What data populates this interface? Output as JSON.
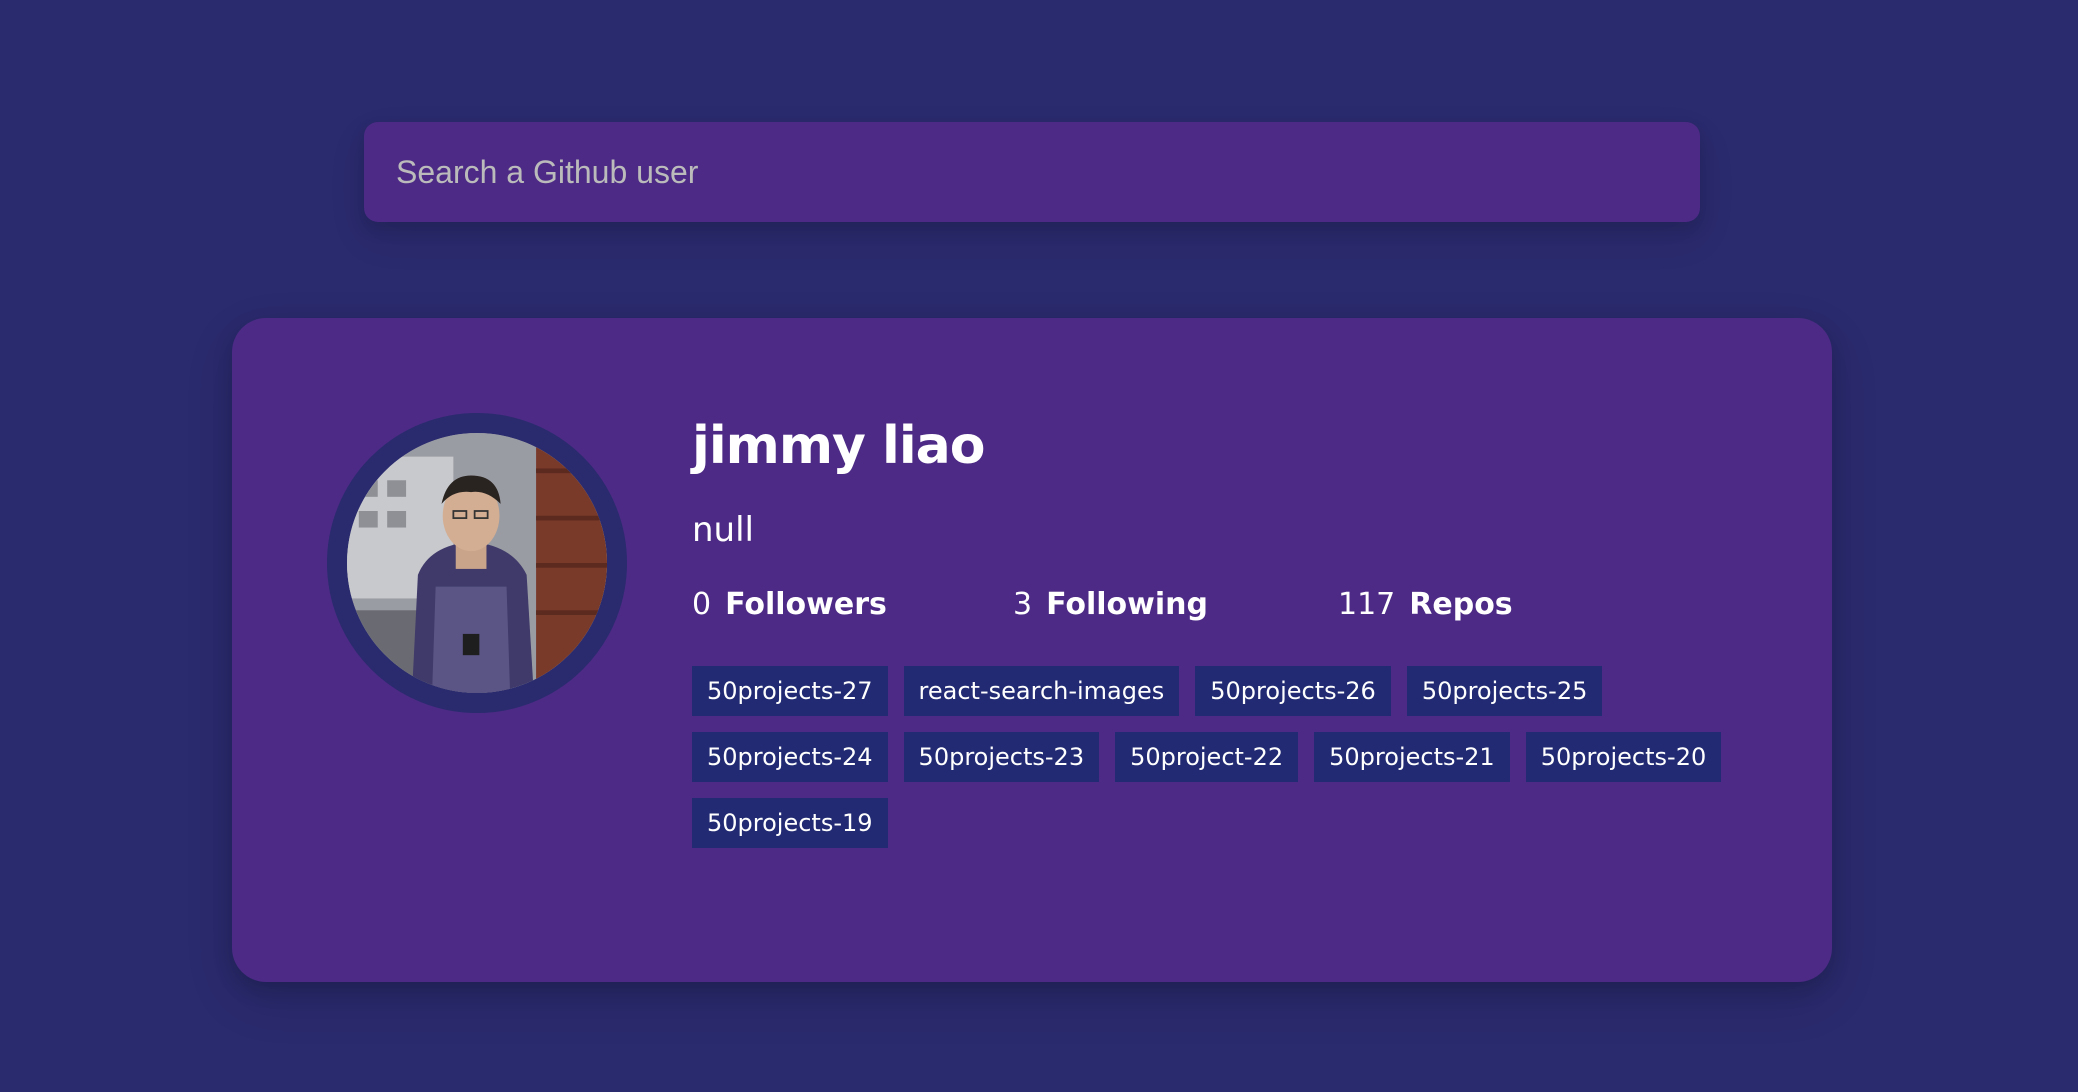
{
  "search": {
    "placeholder": "Search a Github user"
  },
  "profile": {
    "name": "jimmy liao",
    "bio": "null",
    "followers_count": "0",
    "followers_label": "Followers",
    "following_count": "3",
    "following_label": "Following",
    "repos_count": "117",
    "repos_label": "Repos"
  },
  "repos": [
    "50projects-27",
    "react-search-images",
    "50projects-26",
    "50projects-25",
    "50projects-24",
    "50projects-23",
    "50project-22",
    "50projects-21",
    "50projects-20",
    "50projects-19"
  ],
  "colors": {
    "background": "#2a2a6e",
    "card": "#4c2a85",
    "repo_tag": "#212a72",
    "text": "#ffffff"
  }
}
